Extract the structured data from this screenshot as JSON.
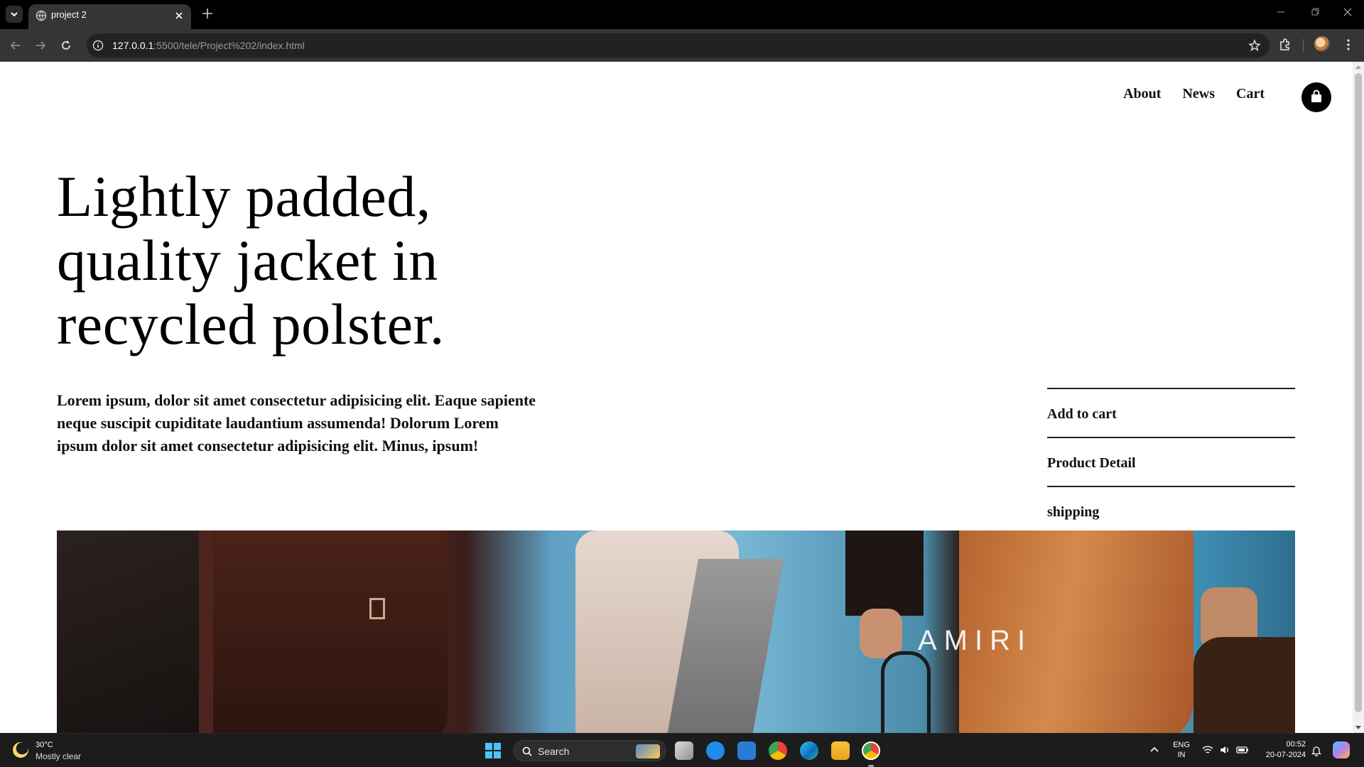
{
  "browser": {
    "tab_title": "project 2",
    "url_host": "127.0.0.1",
    "url_rest": ":5500/tele/Project%202/index.html"
  },
  "nav": {
    "items": [
      "About",
      "News",
      "Cart"
    ]
  },
  "hero": {
    "headline": "Lightly padded, quality jacket in recycled polster.",
    "description": "Lorem ipsum, dolor sit amet consectetur adipisicing elit. Eaque sapiente neque suscipit cupiditate laudantium assumenda! Dolorum Lorem ipsum dolor sit amet consectetur adipisicing elit. Minus, ipsum!",
    "image_brand_text": "AMIRI"
  },
  "side_menu": {
    "items": [
      "Add to cart",
      "Product Detail",
      "shipping"
    ]
  },
  "taskbar": {
    "weather_temp": "30°C",
    "weather_desc": "Mostly clear",
    "search_label": "Search",
    "lang_top": "ENG",
    "lang_bottom": "IN",
    "time": "00:52",
    "date": "20-07-2024"
  },
  "colors": {
    "page_bg": "#ffffff",
    "text": "#111111",
    "chrome_bg": "#353535",
    "taskbar_bg": "#1c1c1c"
  }
}
